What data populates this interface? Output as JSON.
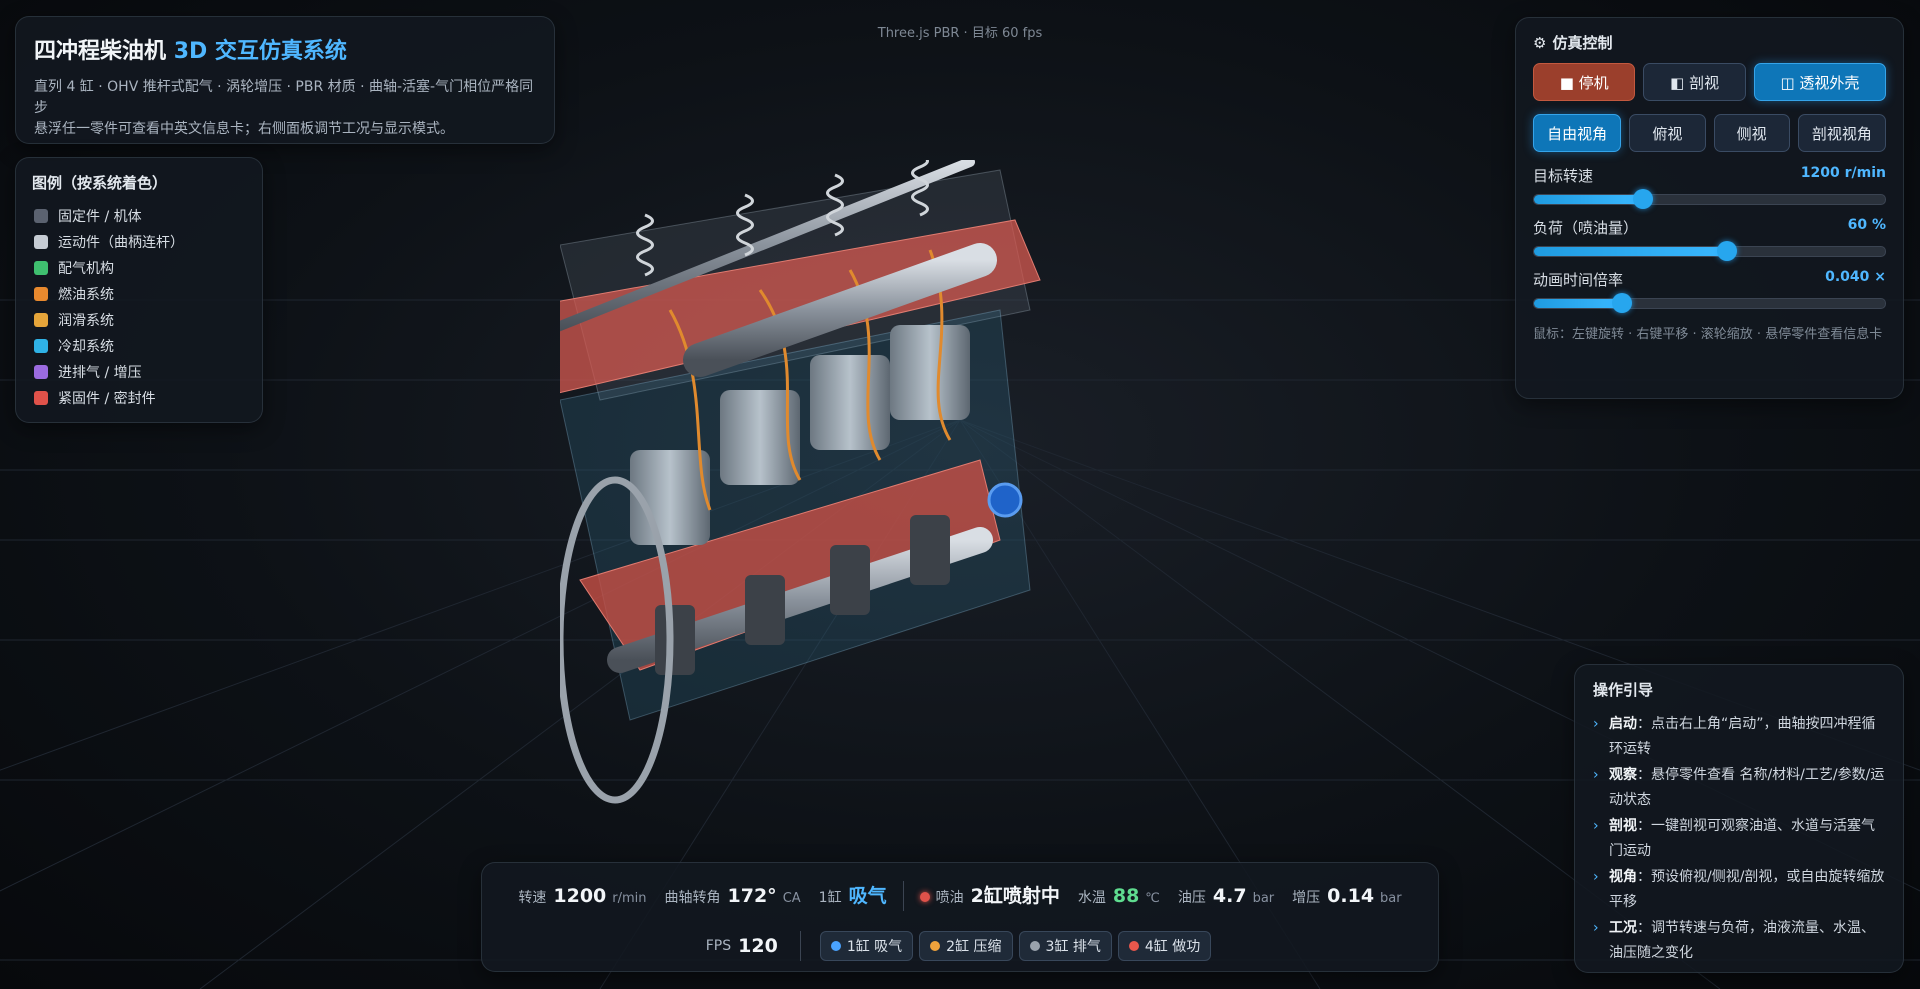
{
  "header": {
    "title_main": "四冲程柴油机",
    "title_accent": "3D 交互仿真系统",
    "line1": "直列 4 缸 · OHV 推杆式配气 · 涡轮增压 · PBR 材质 · 曲轴-活塞-气门相位严格同步",
    "line2": "悬浮任一零件可查看中英文信息卡；右侧面板调节工况与显示模式。"
  },
  "top_info": "Three.js PBR · 目标 60 fps",
  "legend": {
    "title": "图例（按系统着色）",
    "items": [
      {
        "label": "固定件 / 机体",
        "color": "#5b6270"
      },
      {
        "label": "运动件（曲柄连杆）",
        "color": "#c6ccd4"
      },
      {
        "label": "配气机构",
        "color": "#3fbf6f"
      },
      {
        "label": "燃油系统",
        "color": "#e8892e"
      },
      {
        "label": "润滑系统",
        "color": "#e6a53a"
      },
      {
        "label": "冷却系统",
        "color": "#2fb2e6"
      },
      {
        "label": "进排气 / 增压",
        "color": "#9b6be0"
      },
      {
        "label": "紧固件 / 密封件",
        "color": "#e0524a"
      }
    ]
  },
  "controls": {
    "title": "仿真控制",
    "buttons_row1": [
      "■ 停机",
      "◧ 剖视",
      "◫ 透视外壳"
    ],
    "buttons_row2": [
      "自由视角",
      "俯视",
      "侧视",
      "剖视视角"
    ],
    "sliders": [
      {
        "label": "目标转速",
        "value_text": "1200 r/min",
        "fraction": 0.31
      },
      {
        "label": "负荷（喷油量）",
        "value_text": "60 %",
        "fraction": 0.55
      },
      {
        "label": "动画时间倍率",
        "value_text": "0.040 ×",
        "fraction": 0.25
      }
    ],
    "hint": "鼠标：左键旋转 · 右键平移 · 滚轮缩放 · 悬停零件查看信息卡"
  },
  "guide": {
    "title": "操作引导",
    "items": [
      {
        "key": "启动",
        "text": "：点击右上角“启动”，曲轴按四冲程循环运转"
      },
      {
        "key": "观察",
        "text": "：悬停零件查看 名称/材料/工艺/参数/运动状态"
      },
      {
        "key": "剖视",
        "text": "：一键剖视可观察油道、水道与活塞气门运动"
      },
      {
        "key": "视角",
        "text": "：预设俯视/侧视/剖视，或自由旋转缩放平移"
      },
      {
        "key": "工况",
        "text": "：调节转速与负荷，油液流量、水温、油压随之变化"
      }
    ]
  },
  "status": {
    "rpm_label": "转速",
    "rpm_value": "1200",
    "rpm_unit": "r/min",
    "crank_label": "曲轴转角",
    "crank_value": "172°",
    "crank_unit": "CA",
    "cyl1_label": "1缸",
    "cyl1_state": "吸气",
    "inject_label": "喷油",
    "inject_value": "2缸喷射中",
    "water_label": "水温",
    "water_value": "88",
    "water_unit": "℃",
    "oil_label": "油压",
    "oil_value": "4.7",
    "oil_unit": "bar",
    "boost_label": "增压",
    "boost_value": "0.14",
    "boost_unit": "bar",
    "fps_label": "FPS",
    "fps_value": "120",
    "chips": [
      {
        "label": "1缸 吸气",
        "color": "#4aa3ff"
      },
      {
        "label": "2缸 压缩",
        "color": "#f0a33c"
      },
      {
        "label": "3缸 排气",
        "color": "#9aa3ad"
      },
      {
        "label": "4缸 做功",
        "color": "#e8574c"
      }
    ]
  }
}
